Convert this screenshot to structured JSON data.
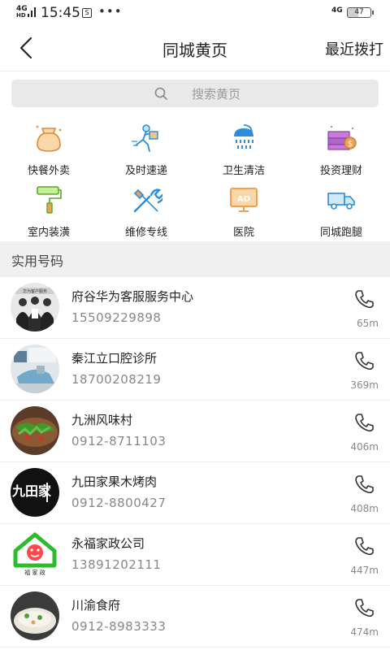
{
  "status_bar": {
    "network_left": "4G",
    "network_sub": "HD",
    "time": "15:45",
    "box_glyph": "S",
    "dots": "•••",
    "network_right": "4G",
    "battery": "47"
  },
  "header": {
    "back_icon": "chevron-left-icon",
    "title": "同城黄页",
    "recent_label": "最近拨打"
  },
  "search": {
    "icon": "search-icon",
    "placeholder": "搜索黄页"
  },
  "categories": [
    {
      "label": "快餐外卖",
      "icon": "food-bag-icon"
    },
    {
      "label": "及时速递",
      "icon": "courier-icon"
    },
    {
      "label": "卫生清洁",
      "icon": "shower-icon"
    },
    {
      "label": "投资理财",
      "icon": "money-stack-icon"
    },
    {
      "label": "室内装潢",
      "icon": "paint-roller-icon"
    },
    {
      "label": "维修专线",
      "icon": "tools-icon"
    },
    {
      "label": "医院",
      "icon": "ad-monitor-icon"
    },
    {
      "label": "同城跑腿",
      "icon": "truck-icon"
    }
  ],
  "section": {
    "title": "实用号码"
  },
  "contacts": [
    {
      "name": "府谷华为客服服务中心",
      "phone": "15509229898",
      "distance": "65m",
      "avatar_text": "华为客户服务"
    },
    {
      "name": "秦江立口腔诊所",
      "phone": "18700208219",
      "distance": "369m",
      "avatar_text": ""
    },
    {
      "name": "九洲风味村",
      "phone": "0912-8711103",
      "distance": "406m",
      "avatar_text": ""
    },
    {
      "name": "九田家果木烤肉",
      "phone": "0912-8800427",
      "distance": "408m",
      "avatar_text": "九田家"
    },
    {
      "name": "永福家政公司",
      "phone": "13891202111",
      "distance": "447m",
      "avatar_text": "福 家 政"
    },
    {
      "name": "川渝食府",
      "phone": "0912-8983333",
      "distance": "474m",
      "avatar_text": ""
    }
  ],
  "colors": {
    "accent_blue": "#2b8ddb",
    "accent_orange": "#f0a050",
    "accent_green": "#3cc43c",
    "accent_purple": "#b066c8"
  }
}
